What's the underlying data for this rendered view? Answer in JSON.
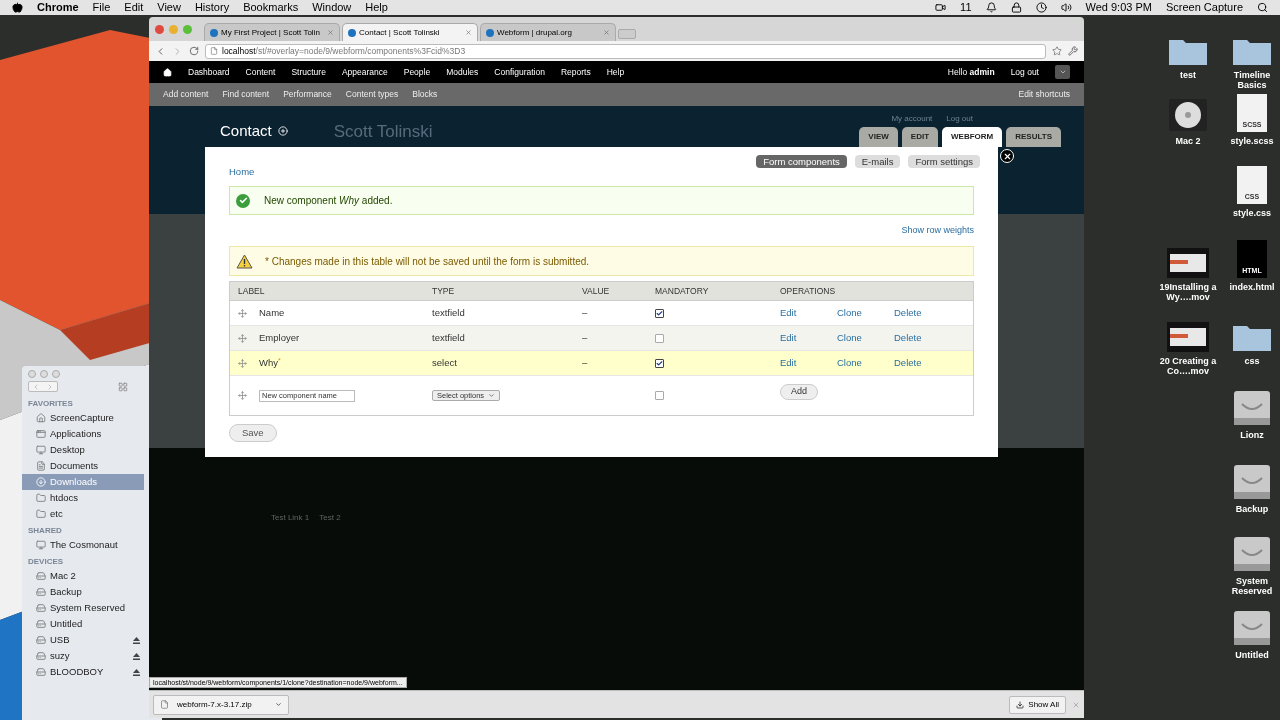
{
  "menubar": {
    "app": "Chrome",
    "menus": [
      "File",
      "Edit",
      "View",
      "History",
      "Bookmarks",
      "Window",
      "Help"
    ],
    "indicator": "11",
    "clock": "Wed 9:03 PM",
    "user": "Screen Capture"
  },
  "finder": {
    "sections": [
      {
        "title": "FAVORITES",
        "items": [
          {
            "name": "ScreenCapture",
            "kind": "home",
            "selected": false,
            "ejectable": false
          },
          {
            "name": "Applications",
            "kind": "apps",
            "selected": false,
            "ejectable": false
          },
          {
            "name": "Desktop",
            "kind": "desktop",
            "selected": false,
            "ejectable": false
          },
          {
            "name": "Documents",
            "kind": "docs",
            "selected": false,
            "ejectable": false
          },
          {
            "name": "Downloads",
            "kind": "downloads",
            "selected": true,
            "ejectable": false
          },
          {
            "name": "htdocs",
            "kind": "folder",
            "selected": false,
            "ejectable": false
          },
          {
            "name": "etc",
            "kind": "folder",
            "selected": false,
            "ejectable": false
          }
        ]
      },
      {
        "title": "SHARED",
        "items": [
          {
            "name": "The Cosmonaut",
            "kind": "computer",
            "selected": false,
            "ejectable": false
          }
        ]
      },
      {
        "title": "DEVICES",
        "items": [
          {
            "name": "Mac 2",
            "kind": "drive",
            "selected": false,
            "ejectable": false
          },
          {
            "name": "Backup",
            "kind": "drive",
            "selected": false,
            "ejectable": false
          },
          {
            "name": "System Reserved",
            "kind": "drive",
            "selected": false,
            "ejectable": false
          },
          {
            "name": "Untitled",
            "kind": "drive",
            "selected": false,
            "ejectable": false
          },
          {
            "name": "USB",
            "kind": "drive",
            "selected": false,
            "ejectable": true
          },
          {
            "name": "suzy",
            "kind": "drive",
            "selected": false,
            "ejectable": true
          },
          {
            "name": "BLOODBOY",
            "kind": "drive",
            "selected": false,
            "ejectable": true
          }
        ]
      }
    ]
  },
  "desktop_icons": [
    {
      "label": "test",
      "kind": "folder"
    },
    {
      "label": "Mac 2",
      "kind": "disk"
    },
    {
      "label": "19Installing a Wy….mov",
      "kind": "movie"
    },
    {
      "label": "20 Creating a Co….mov",
      "kind": "movie"
    },
    {
      "label": "Timeline Basics",
      "kind": "folder"
    },
    {
      "label": "style.scss",
      "kind": "file",
      "badge": "SCSS"
    },
    {
      "label": "style.css",
      "kind": "file",
      "badge": "CSS"
    },
    {
      "label": "index.html",
      "kind": "darkfile",
      "badge": "HTML"
    },
    {
      "label": "css",
      "kind": "folder"
    },
    {
      "label": "Lionz",
      "kind": "drive"
    },
    {
      "label": "Backup",
      "kind": "drive"
    },
    {
      "label": "System Reserved",
      "kind": "drive"
    },
    {
      "label": "Untitled",
      "kind": "drive"
    }
  ],
  "browser": {
    "tabs": [
      {
        "title": "My First Project | Scott Tolin",
        "selected": false
      },
      {
        "title": "Contact | Scott Tolinski",
        "selected": true
      },
      {
        "title": "Webform | drupal.org",
        "selected": false
      }
    ],
    "url_host": "localhost",
    "url_path": "/st/#overlay=node/9/webform/components%3Fcid%3D3",
    "status_url": "localhost/st/node/9/webform/components/1/clone?destination=node/9/webform...",
    "download": {
      "file": "webform-7.x-3.17.zip",
      "show_all": "Show All"
    }
  },
  "toolbar": {
    "items": [
      "Dashboard",
      "Content",
      "Structure",
      "Appearance",
      "People",
      "Modules",
      "Configuration",
      "Reports",
      "Help"
    ],
    "greeting": "Hello **admin**",
    "logout": "Log out"
  },
  "shortcuts": {
    "items": [
      "Add content",
      "Find content",
      "Performance",
      "Content types",
      "Blocks"
    ],
    "edit": "Edit shortcuts"
  },
  "page": {
    "title": "Contact",
    "site_name": "Scott Tolinski",
    "user_links": [
      "My account",
      "Log out"
    ],
    "tabs": [
      {
        "label": "VIEW",
        "selected": false
      },
      {
        "label": "EDIT",
        "selected": false
      },
      {
        "label": "WEBFORM",
        "selected": true
      },
      {
        "label": "RESULTS",
        "selected": false
      }
    ],
    "footer_links": [
      "Test Link 1",
      "Test 2"
    ]
  },
  "overlay": {
    "breadcrumb": "Home",
    "secondary_tabs": [
      {
        "label": "Form components",
        "selected": true
      },
      {
        "label": "E-mails",
        "selected": false
      },
      {
        "label": "Form settings",
        "selected": false
      }
    ],
    "status_message": "New component *Why* added.",
    "row_weights_link": "Show row weights",
    "warning": "* Changes made in this table will not be saved until the form is submitted.",
    "columns": [
      "LABEL",
      "TYPE",
      "VALUE",
      "MANDATORY",
      "OPERATIONS"
    ],
    "rows": [
      {
        "label": "Name",
        "type": "textfield",
        "value": "–",
        "mandatory": true,
        "highlighted": false,
        "operations": [
          "Edit",
          "Clone",
          "Delete"
        ]
      },
      {
        "label": "Employer",
        "type": "textfield",
        "value": "–",
        "mandatory": false,
        "highlighted": false,
        "operations": [
          "Edit",
          "Clone",
          "Delete"
        ]
      },
      {
        "label": "Why",
        "changed_mark": "*",
        "type": "select",
        "value": "–",
        "mandatory": true,
        "highlighted": true,
        "operations": [
          "Edit",
          "Clone",
          "Delete"
        ]
      }
    ],
    "new_row": {
      "placeholder": "New component name",
      "type_select": "Select options",
      "mandatory": false,
      "add": "Add"
    },
    "save": "Save"
  }
}
